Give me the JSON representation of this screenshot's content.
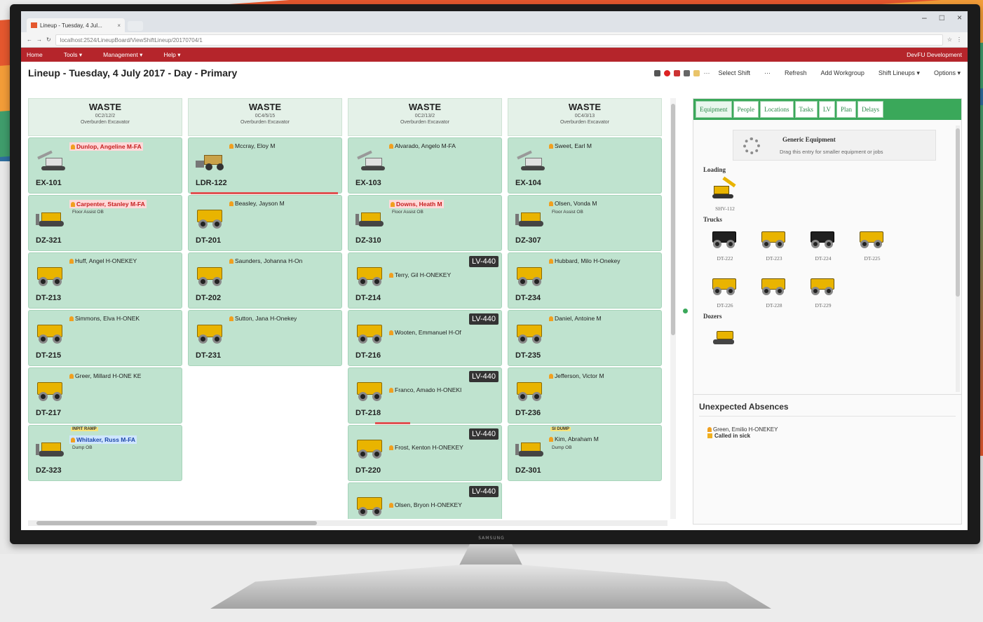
{
  "browser": {
    "tab_title": "Lineup - Tuesday, 4 Jul...",
    "url": "localhost:2524/LineupBoard/ViewShiftLineup/20170704/1",
    "window_controls": [
      "–",
      "□",
      "×"
    ]
  },
  "app_nav": {
    "items": [
      "Home",
      "Tools ▾",
      "Management ▾",
      "Help ▾"
    ],
    "user": "DevFU Development"
  },
  "toolbar": {
    "title": "Lineup - Tuesday, 4 July 2017 - Day - Primary",
    "actions": [
      "Select Shift",
      "···",
      "Refresh",
      "Add Workgroup",
      "Shift Lineups ▾",
      "Options ▾"
    ],
    "more": "···"
  },
  "columns": [
    {
      "title": "WASTE",
      "code": "0C2/12/2",
      "subtitle": "Overburden Excavator",
      "cards": [
        {
          "type": "exc",
          "name": "Dunlop, Angeline M-FA",
          "style": "alert",
          "label": "EX-101"
        },
        {
          "type": "doz",
          "name": "Carpenter, Stanley M-FA",
          "style": "alert",
          "sub": "Floor Assist OB",
          "label": "DZ-321"
        },
        {
          "type": "dump",
          "name": "Huff, Angel H-ONEKEY",
          "label": "DT-213"
        },
        {
          "type": "dump",
          "name": "Simmons, Elva H-ONEK",
          "label": "DT-215"
        },
        {
          "type": "dump",
          "name": "Greer, Millard H-ONE KE",
          "label": "DT-217"
        },
        {
          "type": "doz",
          "pre": "INPIT RAMP",
          "name": "Whitaker, Russ M-FA",
          "style": "blue",
          "sub": "Dump OB",
          "label": "DZ-323"
        }
      ]
    },
    {
      "title": "WASTE",
      "code": "0C4/5/15",
      "subtitle": "Overburden Excavator",
      "cards": [
        {
          "type": "ldr",
          "name": "Mccray, Eloy M",
          "label": "LDR-122",
          "redbar": "full"
        },
        {
          "type": "dump",
          "name": "Beasley, Jayson M",
          "label": "DT-201"
        },
        {
          "type": "dump",
          "name": "Saunders, Johanna H-On",
          "label": "DT-202"
        },
        {
          "type": "dump",
          "name": "Sutton, Jana H-Onekey",
          "label": "DT-231"
        }
      ]
    },
    {
      "title": "WASTE",
      "code": "0C2/13/2",
      "subtitle": "Overburden Excavator",
      "cards": [
        {
          "type": "exc",
          "name": "Alvarado, Angelo M-FA",
          "label": "EX-103"
        },
        {
          "type": "doz",
          "name": "Downs, Heath M",
          "style": "alert",
          "sub": "Floor Assist OB",
          "label": "DZ-310"
        },
        {
          "type": "dump",
          "name": "Terry, Gil H-ONEKEY",
          "label": "DT-214",
          "lv": "LV-440"
        },
        {
          "type": "dump",
          "name": "Wooten, Emmanuel H-Of",
          "label": "DT-216",
          "lv": "LV-440"
        },
        {
          "type": "dump",
          "name": "Franco, Amado H-ONEKI",
          "label": "DT-218",
          "lv": "LV-440",
          "redbar": "short"
        },
        {
          "type": "dump",
          "name": "Frost, Kenton H-ONEKEY",
          "label": "DT-220",
          "lv": "LV-440"
        },
        {
          "type": "dump",
          "name": "Olsen, Bryon H-ONEKEY",
          "label": "",
          "lv": "LV-440"
        }
      ]
    },
    {
      "title": "WASTE",
      "code": "0C4/3/13",
      "subtitle": "Overburden Excavator",
      "cards": [
        {
          "type": "exc",
          "name": "Sweet, Earl M",
          "label": "EX-104"
        },
        {
          "type": "doz",
          "name": "Olsen, Vonda M",
          "sub": "Floor Assist OB",
          "label": "DZ-307"
        },
        {
          "type": "dump",
          "name": "Hubbard, Milo H-Onekey",
          "label": "DT-234"
        },
        {
          "type": "dump",
          "name": "Daniel, Antoine M",
          "label": "DT-235"
        },
        {
          "type": "dump",
          "name": "Jefferson, Victor M",
          "label": "DT-236"
        },
        {
          "type": "doz",
          "pre": "SI DUMP",
          "name": "Kim, Abraham M",
          "sub": "Dump OB",
          "label": "DZ-301"
        }
      ]
    }
  ],
  "panel": {
    "tabs": [
      "Equipment",
      "People",
      "Locations",
      "Tasks",
      "LV",
      "Plan",
      "Delays"
    ],
    "generic": {
      "title": "Generic Equipment",
      "desc": "Drag this entry for smaller equipment or jobs"
    },
    "sections": [
      {
        "name": "Loading",
        "items": [
          {
            "kind": "shovel",
            "label": "SHV-112"
          }
        ]
      },
      {
        "name": "Trucks",
        "items": [
          {
            "kind": "truck-black",
            "label": "DT-222"
          },
          {
            "kind": "truck",
            "label": "DT-223"
          },
          {
            "kind": "truck-black",
            "label": "DT-224"
          },
          {
            "kind": "truck",
            "label": "DT-225"
          },
          {
            "kind": "truck",
            "label": "DT-226"
          },
          {
            "kind": "truck",
            "label": "DT-228"
          },
          {
            "kind": "truck",
            "label": "DT-229"
          }
        ]
      },
      {
        "name": "Dozers",
        "items": [
          {
            "kind": "dozer",
            "label": ""
          }
        ]
      }
    ],
    "absences_title": "Unexpected Absences",
    "absences": [
      {
        "name": "Green, Emilio H-ONEKEY",
        "reason": "Called in sick"
      }
    ]
  },
  "tv_brand": "SAMSUNG",
  "colors": {
    "nav": "#b5252b",
    "card": "#bfe3cf",
    "accent_green": "#3aa85a",
    "alert": "#c41e1e"
  }
}
